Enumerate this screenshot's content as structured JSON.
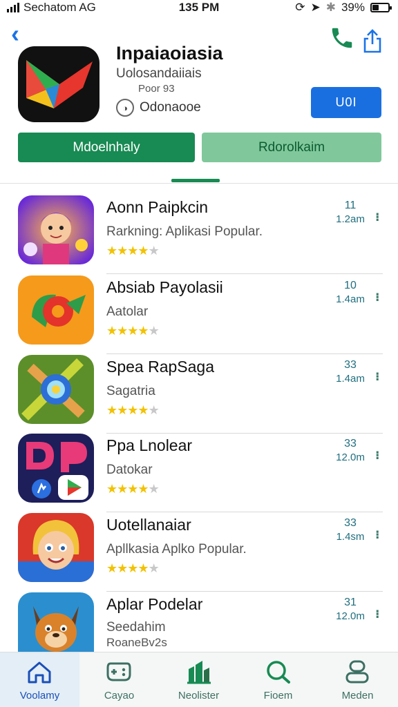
{
  "status_bar": {
    "carrier": "Sechatom AG",
    "time": "135 PM",
    "battery": "39%",
    "battery_level": 0.39
  },
  "header": {
    "title": "Inpaiaoiasia",
    "subtitle": "Uolosandaiiais",
    "meta": "Poor 93",
    "developer": "Odonaooe",
    "get_label": "U0I"
  },
  "tabs": [
    {
      "label": "Mdoelnhaly"
    },
    {
      "label": "Rdorolkaim"
    }
  ],
  "apps": [
    {
      "name": "Aonn Paipkcin",
      "subtitle": "Rarkning: Aplikasi Popular.",
      "subtitle2": "",
      "stars": 4,
      "rank": "11",
      "size": "1.2am"
    },
    {
      "name": "Absiab Payolasii",
      "subtitle": "Aatolar",
      "subtitle2": "",
      "stars": 3.5,
      "rank": "10",
      "size": "1.4am"
    },
    {
      "name": "Spea RapSaga",
      "subtitle": "Sagatria",
      "subtitle2": "",
      "stars": 3.5,
      "rank": "33",
      "size": "1.4am"
    },
    {
      "name": "Ppa Lnolear",
      "subtitle": "Datokar",
      "subtitle2": "",
      "stars": 4,
      "rank": "33",
      "size": "12.0m"
    },
    {
      "name": "Uotellanaiar",
      "subtitle": "Apllkasia Aplko Popular.",
      "subtitle2": "",
      "stars": 4,
      "rank": "33",
      "size": "1.4sm"
    },
    {
      "name": "Aplar Podelar",
      "subtitle": "Seedahim",
      "subtitle2": "RoaneBv2s",
      "stars": 0,
      "rank": "31",
      "size": "12.0m"
    }
  ],
  "bottom_nav": [
    {
      "label": "Voolamy",
      "icon": "home-icon"
    },
    {
      "label": "Cayao",
      "icon": "games-icon"
    },
    {
      "label": "Neolister",
      "icon": "apps-icon"
    },
    {
      "label": "Fioem",
      "icon": "search-icon"
    },
    {
      "label": "Meden",
      "icon": "profile-icon"
    }
  ],
  "colors": {
    "accent_blue": "#1a6fe0",
    "accent_green": "#188a53",
    "accent_green_light": "#80c89b",
    "star": "#f2c200"
  }
}
